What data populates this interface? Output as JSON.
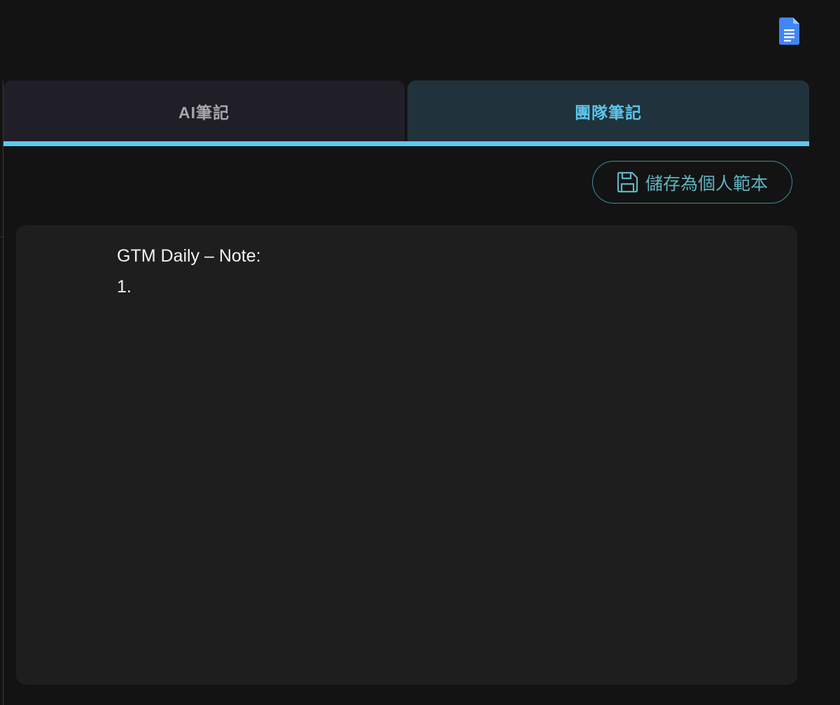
{
  "app_icon": "google-docs-icon",
  "tabs": [
    {
      "label": "AI筆記",
      "active": false
    },
    {
      "label": "團隊筆記",
      "active": true
    }
  ],
  "toolbar": {
    "save_template_label": "儲存為個人範本",
    "save_icon": "floppy-disk-icon"
  },
  "note": {
    "lines": [
      "GTM Daily – Note:",
      "1."
    ]
  },
  "colors": {
    "background": "#131313",
    "accent": "#5ec8f2",
    "active_tab_text": "#5bc5ea",
    "inactive_tab_text": "#a7a7ac",
    "button_outline": "#3e8f9c",
    "docs_blue": "#4285f4",
    "panel": "#1e1e1e"
  }
}
